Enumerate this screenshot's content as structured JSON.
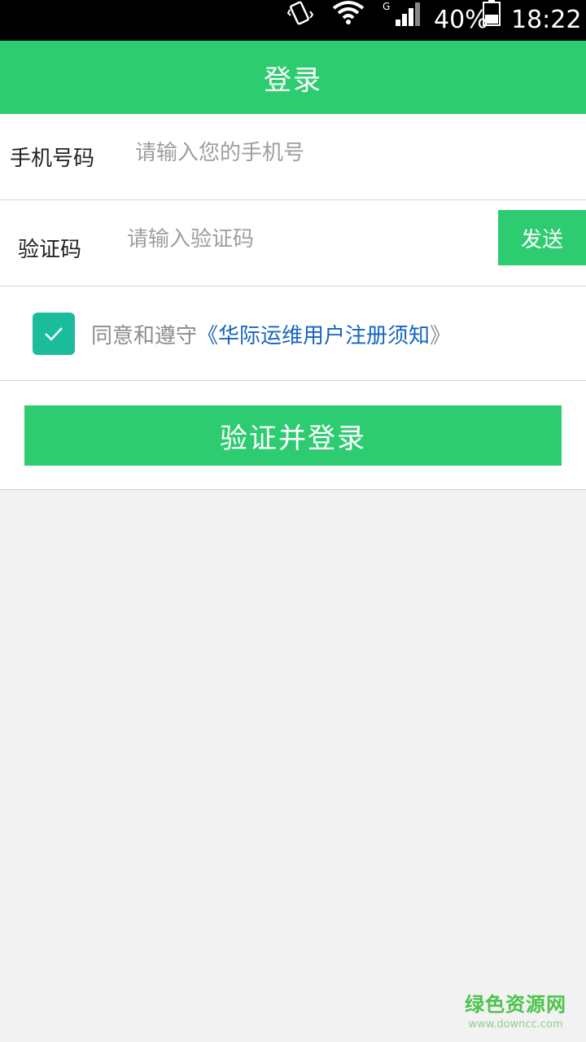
{
  "status_bar": {
    "battery": "40%",
    "time": "18:22",
    "network": "G",
    "icons": [
      "vibrate-icon",
      "wifi-icon",
      "signal-icon",
      "battery-icon"
    ]
  },
  "header": {
    "title": "登录"
  },
  "form": {
    "phone_label": "手机号码",
    "phone_placeholder": "请输入您的手机号",
    "code_label": "验证码",
    "code_placeholder": "请输入验证码",
    "send_label": "发送",
    "agree_prefix": "同意和遵守",
    "agree_link": "《华际运维用户注册须知",
    "agree_suffix": "》",
    "agree_checked": true,
    "submit_label": "验证并登录"
  },
  "watermark": {
    "cn": "绿色资源网",
    "en": "www.downcc.com"
  },
  "colors": {
    "primary": "#2ecc71",
    "checkbox": "#1abc9c",
    "link": "#1565c0",
    "background": "#f2f2f2"
  }
}
